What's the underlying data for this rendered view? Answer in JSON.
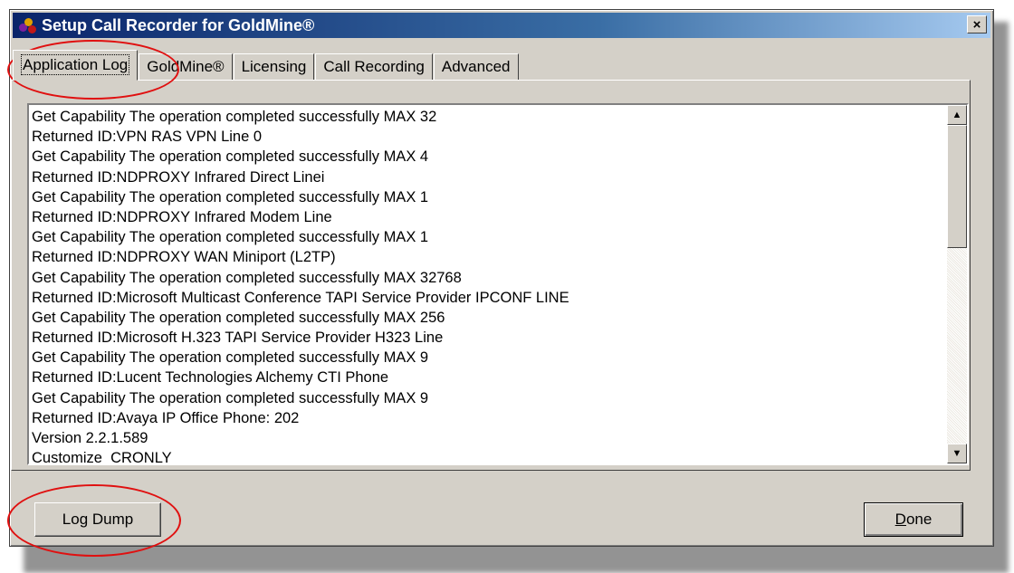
{
  "window": {
    "title": "Setup Call Recorder for GoldMine®",
    "close_label": "×"
  },
  "tabs": [
    {
      "label": "Application Log",
      "active": true
    },
    {
      "label": "GoldMine®",
      "active": false
    },
    {
      "label": "Licensing",
      "active": false
    },
    {
      "label": "Call Recording",
      "active": false
    },
    {
      "label": "Advanced",
      "active": false
    }
  ],
  "log": {
    "lines": [
      "Get Capability The operation completed successfully MAX 32",
      "Returned ID:VPN RAS VPN Line 0",
      "Get Capability The operation completed successfully MAX 4",
      "Returned ID:NDPROXY Infrared Direct Linei",
      "Get Capability The operation completed successfully MAX 1",
      "Returned ID:NDPROXY Infrared Modem Line",
      "Get Capability The operation completed successfully MAX 1",
      "Returned ID:NDPROXY WAN Miniport (L2TP)",
      "Get Capability The operation completed successfully MAX 32768",
      "Returned ID:Microsoft Multicast Conference TAPI Service Provider IPCONF LINE",
      "Get Capability The operation completed successfully MAX 256",
      "Returned ID:Microsoft H.323 TAPI Service Provider H323 Line",
      "Get Capability The operation completed successfully MAX 9",
      "Returned ID:Lucent Technologies Alchemy CTI Phone",
      "Get Capability The operation completed successfully MAX 9",
      "Returned ID:Avaya IP Office Phone: 202",
      "Version 2.2.1.589",
      "Customize_CRONLY"
    ],
    "scroll_up_icon": "▲",
    "scroll_down_icon": "▼"
  },
  "buttons": {
    "log_dump": "Log Dump",
    "done_mnemonic": "D",
    "done_rest": "one"
  },
  "annotation_color": "#e01010"
}
